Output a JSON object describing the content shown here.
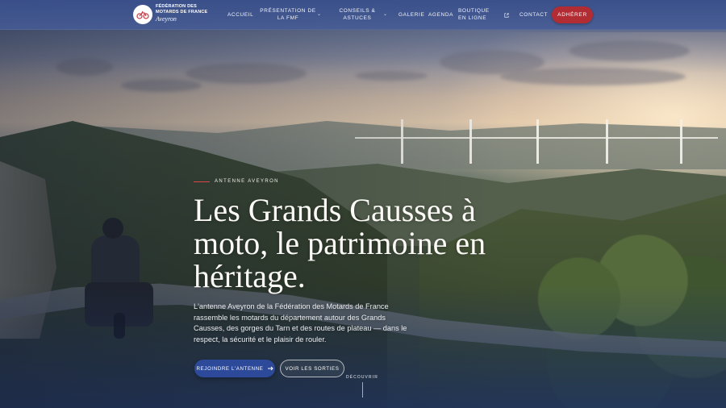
{
  "header": {
    "brand_line1": "Fédération des Motards de France",
    "brand_line2": "Aveyron",
    "logo_icon": "motorcycle-icon",
    "nav": [
      {
        "label": "Accueil"
      },
      {
        "label": "Présentation de la FMF",
        "dropdown": true
      },
      {
        "label": "Conseils & astuces",
        "dropdown": true
      },
      {
        "label": "Galerie"
      },
      {
        "label": "Agenda"
      },
      {
        "label": "Boutique en ligne",
        "external": true
      },
      {
        "label": "Contact"
      }
    ],
    "cta_label": "Adhérer"
  },
  "hero": {
    "eyebrow": "Antenne Aveyron",
    "title": "Les Grands Causses à moto, le patrimoine en héritage.",
    "lead": "L'antenne Aveyron de la Fédération des Motards de France rassemble les motards du département autour des Grands Causses, des gorges du Tarn et des routes de plateau — dans le respect, la sécurité et le plaisir de rouler.",
    "primary_button": "Rejoindre l'antenne",
    "secondary_button": "Voir les sorties",
    "scroll_label": "Découvrir"
  },
  "colors": {
    "header_bg": "#3a508c",
    "cta": "#b22d33",
    "primary_button": "#2d4a9a",
    "eyebrow_rule": "#d84a4a"
  }
}
